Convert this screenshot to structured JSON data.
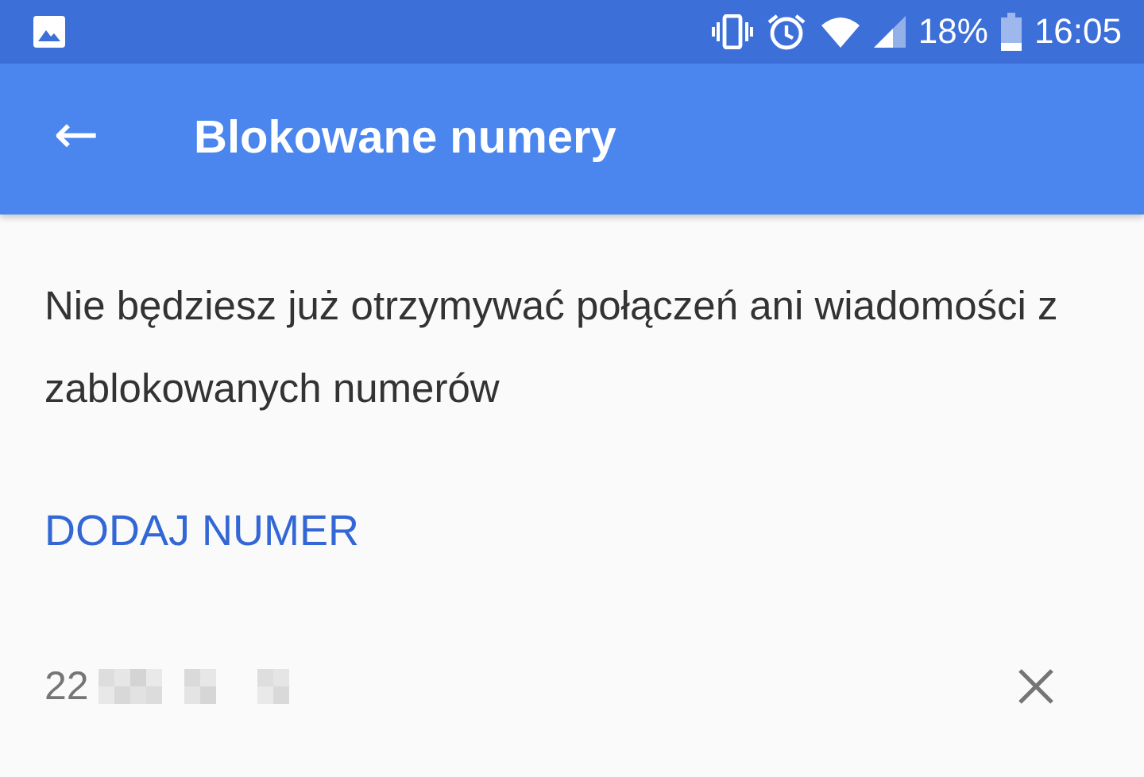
{
  "status_bar": {
    "battery_percent": "18%",
    "time": "16:05"
  },
  "app_bar": {
    "back": "←",
    "title": "Blokowane numery"
  },
  "description": "Nie będziesz już otrzymywać połączeń ani wiadomości z zablokowanych numerów",
  "add_button": "DODAJ NUMER",
  "blocked_numbers": [
    {
      "visible_digits": "22",
      "redacted": true
    }
  ]
}
